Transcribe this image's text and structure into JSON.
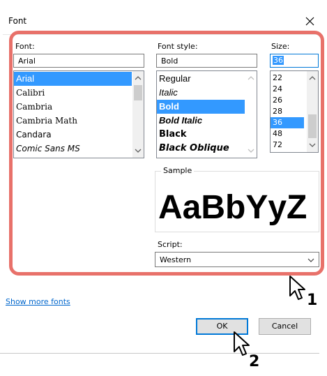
{
  "dialog": {
    "title": "Font"
  },
  "font": {
    "label": "Font:",
    "value": "Arial",
    "items": [
      "Arial",
      "Calibri",
      "Cambria",
      "Cambria Math",
      "Candara",
      "Comic Sans MS"
    ],
    "selected": "Arial"
  },
  "style": {
    "label": "Font style:",
    "value": "Bold",
    "items": [
      "Regular",
      "Italic",
      "Bold",
      "Bold Italic",
      "Black",
      "Black Oblique"
    ],
    "selected": "Bold"
  },
  "size": {
    "label": "Size:",
    "value": "36",
    "items": [
      "22",
      "24",
      "26",
      "28",
      "36",
      "48",
      "72"
    ],
    "selected": "36"
  },
  "sample": {
    "label": "Sample",
    "text": "AaBbYyZ"
  },
  "script": {
    "label": "Script:",
    "value": "Western"
  },
  "links": {
    "show_more_fonts": "Show more fonts"
  },
  "buttons": {
    "ok": "OK",
    "cancel": "Cancel"
  },
  "callouts": {
    "one": "1",
    "two": "2"
  },
  "colors": {
    "highlight_ring": "#e8716a",
    "selection": "#3399ff",
    "link": "#0066cc"
  }
}
